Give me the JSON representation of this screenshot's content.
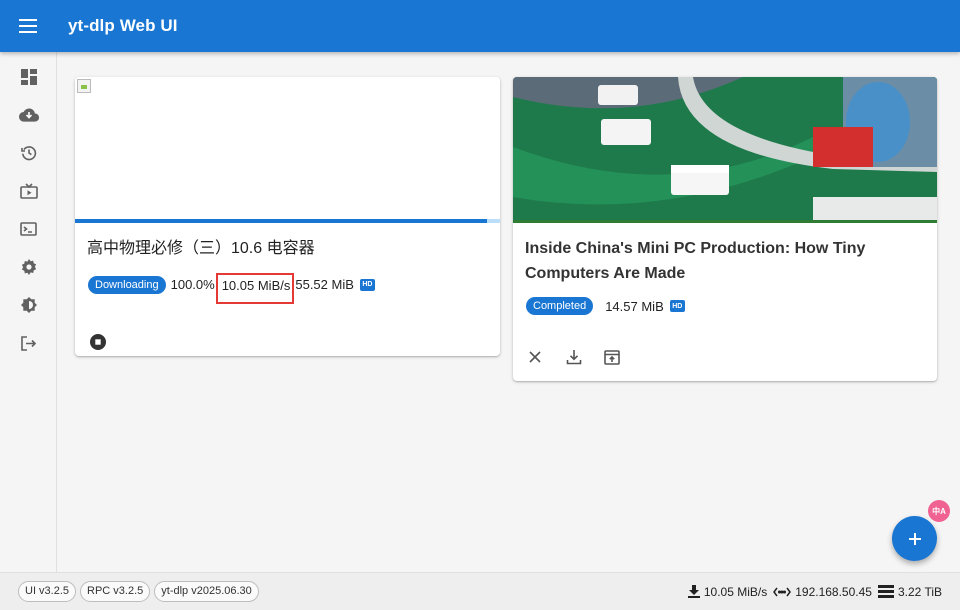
{
  "app": {
    "title": "yt-dlp Web UI"
  },
  "sidebar": {
    "items": [
      {
        "icon": "dashboard-icon"
      },
      {
        "icon": "cloud-download-icon"
      },
      {
        "icon": "history-icon"
      },
      {
        "icon": "subscriptions-icon"
      },
      {
        "icon": "terminal-icon"
      },
      {
        "icon": "settings-icon"
      },
      {
        "icon": "theme-icon"
      },
      {
        "icon": "logout-icon"
      }
    ]
  },
  "downloads": [
    {
      "title": "高中物理必修（三）10.6 电容器",
      "status": "Downloading",
      "progress_label": "100.0%",
      "progress_fraction": 0.97,
      "speed": "10.05 MiB/s",
      "size": "55.52 MiB",
      "quality_badge": "HD",
      "actions": [
        "stop-icon"
      ]
    },
    {
      "title": "Inside China's Mini PC Production: How Tiny Computers Are Made",
      "status": "Completed",
      "size": "14.57 MiB",
      "quality_badge": "HD",
      "actions": [
        "close-icon",
        "download-icon",
        "open-in-player-icon"
      ]
    }
  ],
  "footer": {
    "versions": [
      "UI v3.2.5",
      "RPC v3.2.5",
      "yt-dlp v2025.06.30"
    ],
    "download_speed": "10.05 MiB/s",
    "host": "192.168.50.45",
    "free_space": "3.22 TiB"
  },
  "colors": {
    "primary": "#1976d2",
    "highlight_box": "#e53935"
  }
}
